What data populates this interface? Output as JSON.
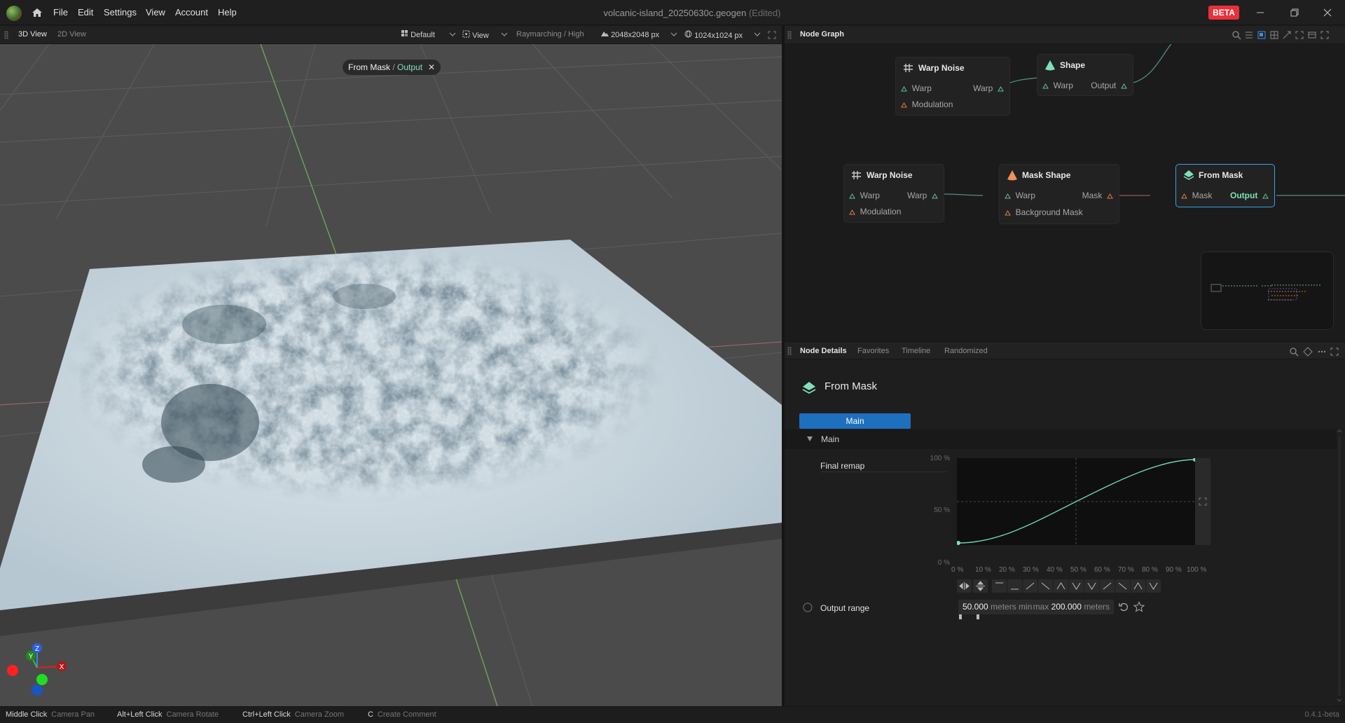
{
  "menu": {
    "items": [
      "File",
      "Edit",
      "Settings",
      "View",
      "Account",
      "Help"
    ],
    "document_title": "volcanic-island_20250630c.geogen",
    "edited_marker": "(Edited)",
    "badge": "BETA"
  },
  "viewport_toolbar": {
    "tabs": [
      "3D View",
      "2D View"
    ],
    "active_tab": "3D View",
    "preset": "Default",
    "view_menu": "View",
    "render_mode": "Raymarching / High",
    "resolution": "2048x2048 px",
    "preview_resolution": "1024x1024 px"
  },
  "viewport": {
    "chip_node": "From Mask",
    "chip_separator": "/",
    "chip_port": "Output",
    "axis_labels": {
      "x": "X",
      "y": "Y",
      "z": "Z"
    }
  },
  "node_graph": {
    "title": "Node Graph",
    "nodes": [
      {
        "title": "Warp Noise",
        "inputs": [
          "Warp",
          "Modulation"
        ],
        "outputs": [
          "Warp"
        ]
      },
      {
        "title": "Shape",
        "inputs": [
          "Warp"
        ],
        "outputs": [
          "Output"
        ]
      },
      {
        "title": "Warp Noise",
        "inputs": [
          "Warp",
          "Modulation"
        ],
        "outputs": [
          "Warp"
        ]
      },
      {
        "title": "Mask Shape",
        "inputs": [
          "Warp",
          "Background Mask"
        ],
        "outputs": [
          "Mask"
        ]
      },
      {
        "title": "From Mask",
        "inputs": [
          "Mask"
        ],
        "outputs": [
          "Output"
        ],
        "selected": true
      }
    ]
  },
  "details": {
    "tabs": [
      "Node Details",
      "Favorites",
      "Timeline",
      "Randomized"
    ],
    "active_tab": "Node Details",
    "node_title": "From Mask",
    "section_tab": "Main",
    "group_label": "Main",
    "final_remap": {
      "label": "Final remap",
      "y_ticks": [
        "100 %",
        "50 %",
        "0 %"
      ],
      "x_ticks": [
        "0 %",
        "10 %",
        "20 %",
        "30 %",
        "40 %",
        "50 %",
        "60 %",
        "70 %",
        "80 %",
        "90 %",
        "100 %"
      ]
    },
    "output_range": {
      "label": "Output range",
      "min_value": "50.000",
      "min_unit": "meters min",
      "max_prefix": "max",
      "max_value": "200.000",
      "max_unit": "meters"
    }
  },
  "statusbar": {
    "hints": [
      {
        "key": "Middle Click",
        "action": "Camera Pan"
      },
      {
        "key": "Alt+Left Click",
        "action": "Camera Rotate"
      },
      {
        "key": "Ctrl+Left Click",
        "action": "Camera Zoom"
      },
      {
        "key": "C",
        "action": "Create Comment"
      }
    ],
    "version": "0.4.1-beta"
  },
  "colors": {
    "accent": "#1f6fbf",
    "selection": "#3aa0e8",
    "port_highlight": "#7fe0b8",
    "beta": "#e8313b",
    "curve": "#6fd3b6"
  }
}
